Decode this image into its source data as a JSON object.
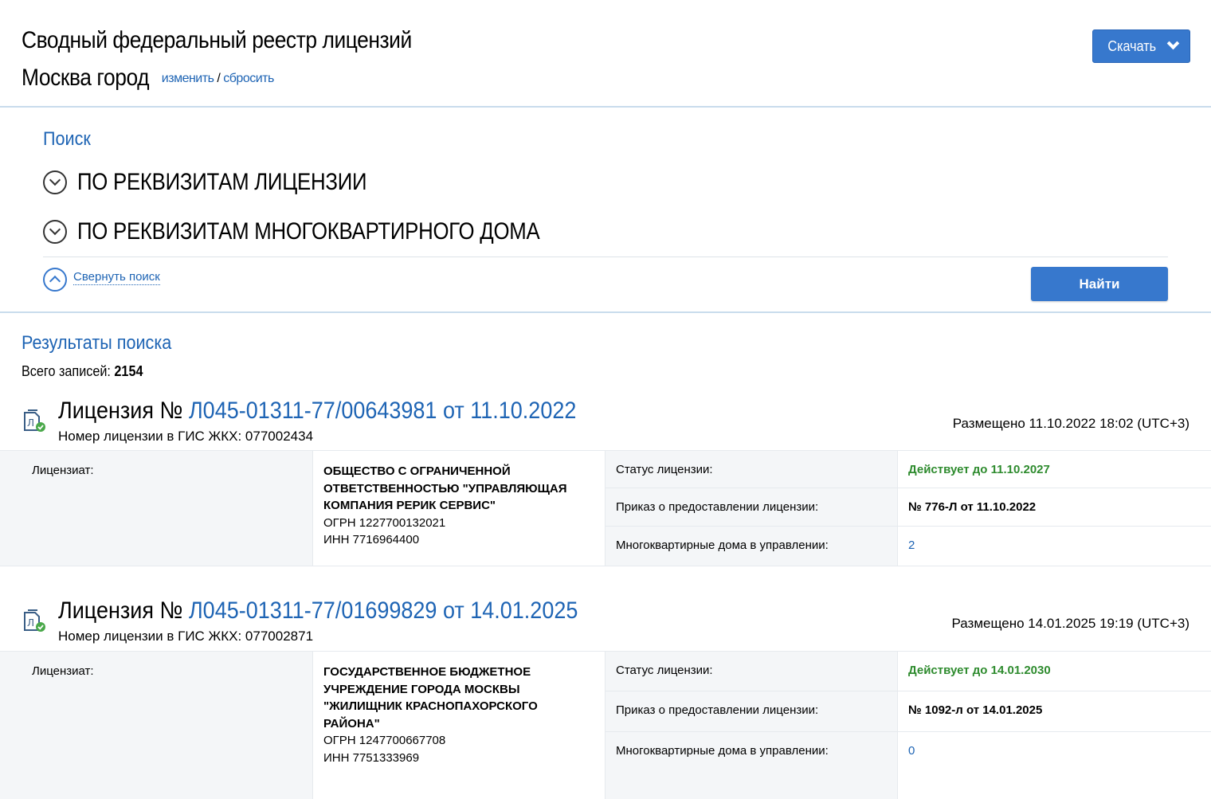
{
  "header": {
    "title": "Сводный федеральный реестр лицензий",
    "region": "Москва город",
    "change_link": "изменить",
    "separator": "/",
    "reset_link": "сбросить",
    "download_button": "Скачать"
  },
  "search": {
    "title": "Поиск",
    "criteria": [
      "ПО РЕКВИЗИТАМ ЛИЦЕНЗИИ",
      "ПО РЕКВИЗИТАМ МНОГОКВАРТИРНОГО ДОМА"
    ],
    "collapse_label": "Свернуть поиск",
    "find_button": "Найти"
  },
  "results": {
    "title": "Результаты поиска",
    "total_label": "Всего записей:",
    "total_value": "2154",
    "licenses": [
      {
        "prefix": "Лицензия №",
        "number": "Л045-01311-77/00643981 от 11.10.2022",
        "gis_number": "Номер лицензии в ГИС ЖКХ: 077002434",
        "posted": "Размещено 11.10.2022 18:02 (UTC+3)",
        "licensee_label": "Лицензиат:",
        "org_name": "ОБЩЕСТВО С ОГРАНИЧЕННОЙ ОТВЕТСТВЕННОСТЬЮ \"УПРАВЛЯЮЩАЯ КОМПАНИЯ РЕРИК СЕРВИС\"",
        "ogrn": "ОГРН 1227700132021",
        "inn": "ИНН 7716964400",
        "status_label": "Статус лицензии:",
        "status_value": "Действует до 11.10.2027",
        "order_label": "Приказ о предоставлении лицензии:",
        "order_value": "№ 776-Л от 11.10.2022",
        "houses_label": "Многоквартирные дома в управлении:",
        "houses_value": "2"
      },
      {
        "prefix": "Лицензия №",
        "number": "Л045-01311-77/01699829 от 14.01.2025",
        "gis_number": "Номер лицензии в ГИС ЖКХ: 077002871",
        "posted": "Размещено 14.01.2025 19:19 (UTC+3)",
        "licensee_label": "Лицензиат:",
        "org_name": "ГОСУДАРСТВЕННОЕ БЮДЖЕТНОЕ УЧРЕЖДЕНИЕ ГОРОДА МОСКВЫ \"ЖИЛИЩНИК КРАСНОПАХОРСКОГО РАЙОНА\"",
        "ogrn": "ОГРН 1247700667708",
        "inn": "ИНН 7751333969",
        "status_label": "Статус лицензии:",
        "status_value": "Действует до 14.01.2030",
        "order_label": "Приказ о предоставлении лицензии:",
        "order_value": "№ 1092-л от 14.01.2025",
        "houses_label": "Многоквартирные дома в управлении:",
        "houses_value": "0"
      }
    ]
  },
  "colors": {
    "accent": "#3778cd",
    "link": "#1e64b4",
    "status_active": "#2e8b2e",
    "panel_bg": "#f4f6f8"
  }
}
